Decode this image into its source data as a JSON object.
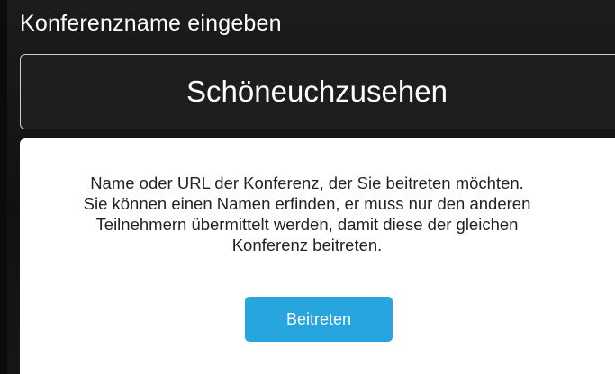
{
  "header": {
    "prompt": "Konferenzname eingeben"
  },
  "conference_input": {
    "value": "Schöneuchzusehen"
  },
  "info": {
    "lines": [
      "Name oder URL der Konferenz, der Sie beitreten möchten.",
      "Sie können einen Namen erfinden, er muss nur den anderen",
      "Teilnehmern übermittelt werden, damit diese der gleichen",
      "Konferenz beitreten."
    ]
  },
  "actions": {
    "join_label": "Beitreten"
  },
  "colors": {
    "background": "#141414",
    "accent": "#27a5df",
    "card": "#ffffff",
    "input_border": "#cfcfcf"
  }
}
